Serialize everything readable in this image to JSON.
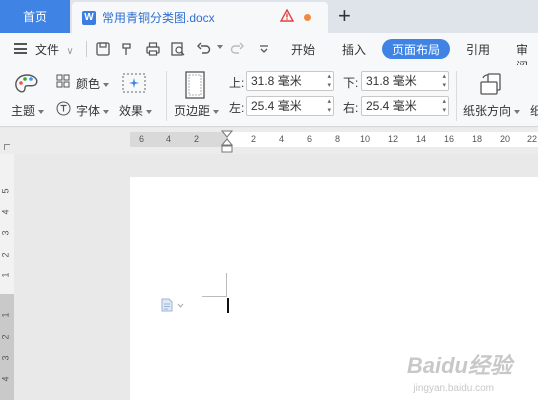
{
  "tabs": {
    "home": "首页",
    "document": "常用青铜分类图.docx"
  },
  "menu": {
    "file": "文件",
    "items": [
      "开始",
      "插入",
      "页面布局",
      "引用",
      "审阅"
    ]
  },
  "ribbon": {
    "theme": "主题",
    "color": "颜色",
    "font": "字体",
    "effects": "效果",
    "margins": "页边距",
    "top_label": "上:",
    "top_value": "31.8 毫米",
    "bottom_label": "下:",
    "bottom_value": "31.8 毫米",
    "left_label": "左:",
    "left_value": "25.4 毫米",
    "right_label": "右:",
    "right_value": "25.4 毫米",
    "orientation": "纸张方向",
    "size_partial": "纸"
  },
  "ruler": {
    "h_ticks": [
      "6",
      "4",
      "2",
      "2",
      "4",
      "6",
      "8",
      "10",
      "12",
      "14",
      "16",
      "18",
      "20",
      "22"
    ],
    "v_ticks": [
      "5",
      "4",
      "3",
      "2",
      "1",
      "1",
      "2",
      "3",
      "4"
    ]
  },
  "watermark": {
    "brand": "Baidu经验",
    "url": "jingyan.baidu.com"
  },
  "colors": {
    "accent": "#3f84e5",
    "tab_bar": "#dfe3ea",
    "ribbon": "#f7f8fa"
  }
}
